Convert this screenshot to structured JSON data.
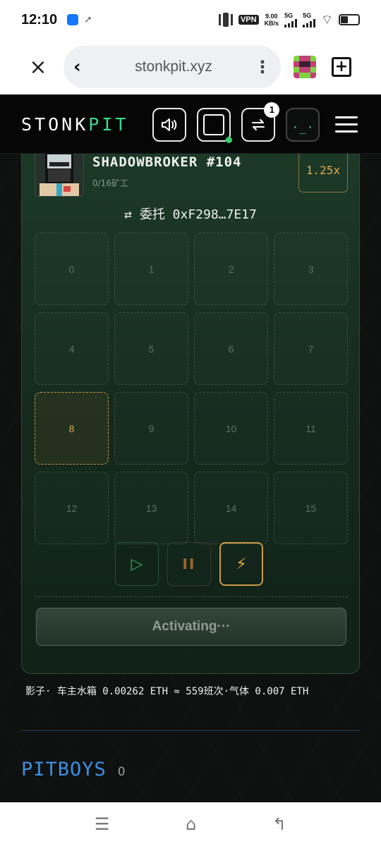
{
  "status_bar": {
    "time": "12:10",
    "vpn": "VPN",
    "speed_value": "9.00",
    "speed_unit": "KB/s",
    "sig1_label": "5G",
    "sig2_label": "5G"
  },
  "browser": {
    "url": "stonkpit.xyz",
    "back_icon": "‹",
    "close_icon": "×",
    "more_icon": "⋮",
    "newtab_icon": "+"
  },
  "header": {
    "logo_part1": "STONK",
    "logo_part2": "PIT",
    "swap_badge": "1",
    "terminal_face": "·_·"
  },
  "bot": {
    "name": "SHADOWBROKER #104",
    "miners": "0/16矿工",
    "multiplier": "1.25x",
    "delegate_label": "⇄ 委托  0xF298…7E17"
  },
  "grid": {
    "slots": [
      "0",
      "1",
      "2",
      "3",
      "4",
      "5",
      "6",
      "7",
      "8",
      "9",
      "10",
      "11",
      "12",
      "13",
      "14",
      "15"
    ],
    "active_slot": "8"
  },
  "controls": {
    "play_icon": "▷",
    "pause_icon": "II",
    "bolt_icon": "⚡"
  },
  "activate_button": "Activating···",
  "info_line": "影子· 车主水箱 0.00262 ETH ≈ 559班次·气体 0.007 ETH",
  "pitboys": {
    "title": "PITBOYS",
    "count": "0"
  },
  "nav": {
    "menu_icon": "☰",
    "home_icon": "⌂",
    "back_icon": "↰"
  },
  "colors": {
    "accent_green": "#39d98a",
    "gold": "#e0a84b",
    "blue": "#3f8fe0"
  }
}
